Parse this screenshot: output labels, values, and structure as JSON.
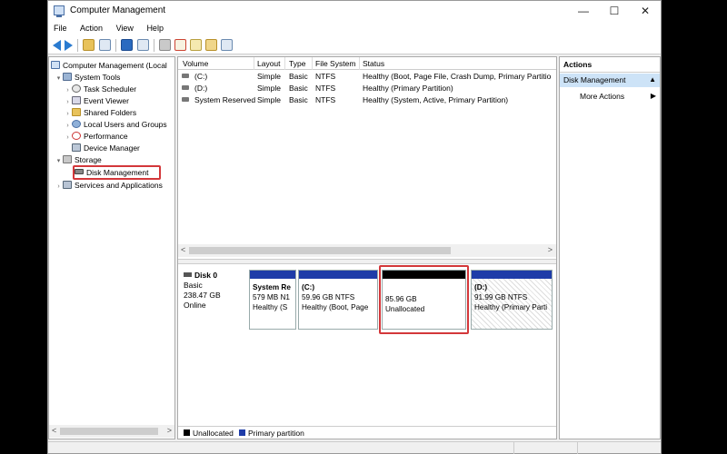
{
  "window": {
    "title": "Computer Management"
  },
  "controls": {
    "minimize": "—",
    "maximize": "☐",
    "close": "✕"
  },
  "menu": [
    "File",
    "Action",
    "View",
    "Help"
  ],
  "tree": {
    "root": "Computer Management (Local",
    "system_tools": "System Tools",
    "task_scheduler": "Task Scheduler",
    "event_viewer": "Event Viewer",
    "shared_folders": "Shared Folders",
    "local_users": "Local Users and Groups",
    "performance": "Performance",
    "device_manager": "Device Manager",
    "storage": "Storage",
    "disk_management": "Disk Management",
    "services": "Services and Applications"
  },
  "volumes": {
    "headers": [
      "Volume",
      "Layout",
      "Type",
      "File System",
      "Status"
    ],
    "rows": [
      [
        "(C:)",
        "Simple",
        "Basic",
        "NTFS",
        "Healthy (Boot, Page File, Crash Dump, Primary Partitio"
      ],
      [
        "(D:)",
        "Simple",
        "Basic",
        "NTFS",
        "Healthy (Primary Partition)"
      ],
      [
        "System Reserved",
        "Simple",
        "Basic",
        "NTFS",
        "Healthy (System, Active, Primary Partition)"
      ]
    ]
  },
  "scroll": {
    "left": "<",
    "right": ">"
  },
  "disk": {
    "name": "Disk 0",
    "type": "Basic",
    "size": "238.47 GB",
    "status": "Online"
  },
  "partitions": [
    {
      "name": "System Re",
      "size": "579 MB N1",
      "status": "Healthy (S",
      "color": "#1e3ca8"
    },
    {
      "name": "(C:)",
      "size": "59.96 GB NTFS",
      "status": "Healthy (Boot, Page",
      "color": "#1e3ca8"
    },
    {
      "name": "",
      "size": "85.96 GB",
      "status": "Unallocated",
      "color": "#000000"
    },
    {
      "name": "(D:)",
      "size": "91.99 GB NTFS",
      "status": "Healthy (Primary Parti",
      "color": "#1e3ca8"
    }
  ],
  "legend": {
    "unallocated": "Unallocated",
    "primary": "Primary partition"
  },
  "actions": {
    "title": "Actions",
    "selected": "Disk Management",
    "more": "More Actions"
  },
  "colors": {
    "primary": "#1e3ca8",
    "unallocated": "#000000",
    "highlight": "#d3373a",
    "selection": "#cde3f7"
  }
}
